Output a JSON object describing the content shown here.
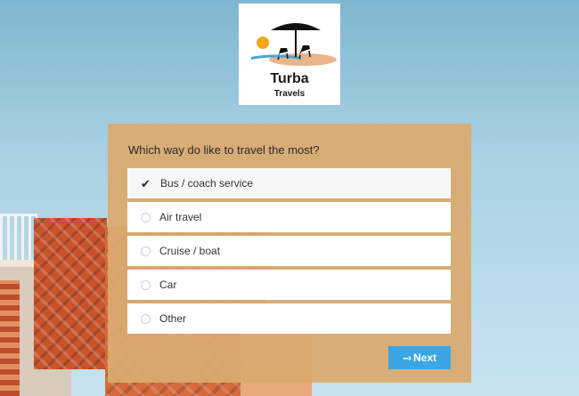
{
  "brand": {
    "name": "Turba",
    "tagline": "Travels"
  },
  "survey": {
    "question": "Which way do like to travel the most?",
    "options": [
      {
        "label": "Bus / coach service",
        "selected": true
      },
      {
        "label": "Air travel",
        "selected": false
      },
      {
        "label": "Cruise / boat",
        "selected": false
      },
      {
        "label": "Car",
        "selected": false
      },
      {
        "label": "Other",
        "selected": false
      }
    ],
    "next_label": "Next",
    "next_icon": "dashed-arrow-right-icon"
  },
  "colors": {
    "panel": "#daaa6e",
    "button": "#3aa6e6",
    "sky": "#a9d2e3"
  }
}
